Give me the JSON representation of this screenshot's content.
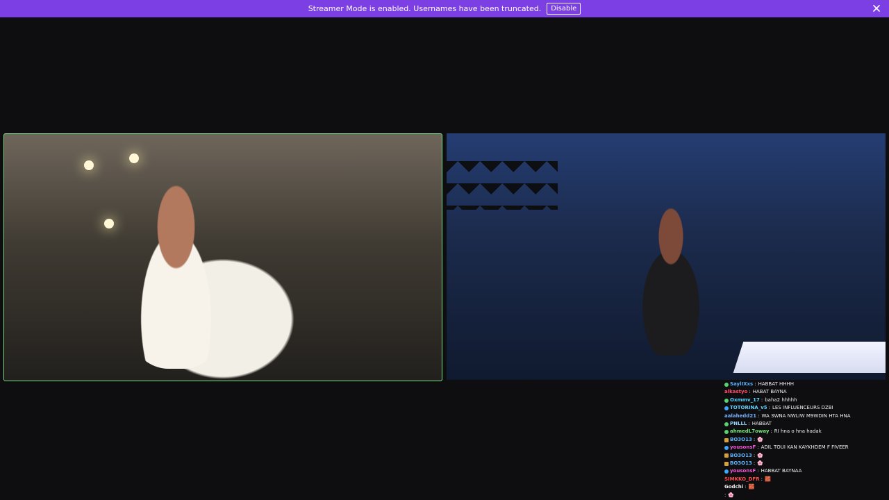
{
  "banner": {
    "message": "Streamer Mode is enabled. Usernames have been truncated.",
    "button_label": "Disable",
    "close_icon": "close-icon"
  },
  "colors": {
    "accent": "#7b3fe4",
    "border_highlight": "#7de08f",
    "background": "#0e0e10"
  },
  "chat": {
    "lines": [
      {
        "badge": "green",
        "user": "SaylIXxs",
        "user_color": "#55b1ff",
        "message": "HABBAT HHHH"
      },
      {
        "badge": "",
        "user": "alkastyo",
        "user_color": "#ff4f6d",
        "message": "HABAT BAYNA"
      },
      {
        "badge": "green",
        "user": "Oxmmv_17",
        "user_color": "#55d4ff",
        "message": "baha2 hhhhh"
      },
      {
        "badge": "blue",
        "user": "TOTORINA_v5",
        "user_color": "#64d3ff",
        "message": "LES INFLUENCEURS DZBI"
      },
      {
        "badge": "",
        "user": "aalahedd21",
        "user_color": "#76b2ff",
        "message": "WA 3WNA NWLIW M9WDIN HTA HNA"
      },
      {
        "badge": "green",
        "user": "PNLLL",
        "user_color": "#93d7ff",
        "message": "HABBAT"
      },
      {
        "badge": "green",
        "user": "ahmedL7oway",
        "user_color": "#73e37a",
        "message": "RI hna o hna hadak"
      },
      {
        "badge": "gold",
        "user": "BO3O13",
        "user_color": "#5fb4ff",
        "message": "🌸"
      },
      {
        "badge": "blue",
        "user": "yousonsF",
        "user_color": "#f05ad6",
        "message": "ADIL TOUI KAN KAYKHDEM F FIVEER"
      },
      {
        "badge": "gold",
        "user": "BO3O13",
        "user_color": "#5fb4ff",
        "message": "🌸"
      },
      {
        "badge": "gold",
        "user": "BO3O13",
        "user_color": "#5fb4ff",
        "message": "🌸"
      },
      {
        "badge": "blue",
        "user": "yousonsF",
        "user_color": "#f05ad6",
        "message": "HABBAT BAYNAA"
      },
      {
        "badge": "",
        "user": "SIMKKO_DFR",
        "user_color": "#ff4c4c",
        "message": "🧱"
      },
      {
        "badge": "",
        "user": "Godchi",
        "user_color": "#efeff1",
        "message": "🧱"
      },
      {
        "badge": "",
        "user": "",
        "user_color": "#efeff1",
        "message": "🌸"
      }
    ]
  }
}
